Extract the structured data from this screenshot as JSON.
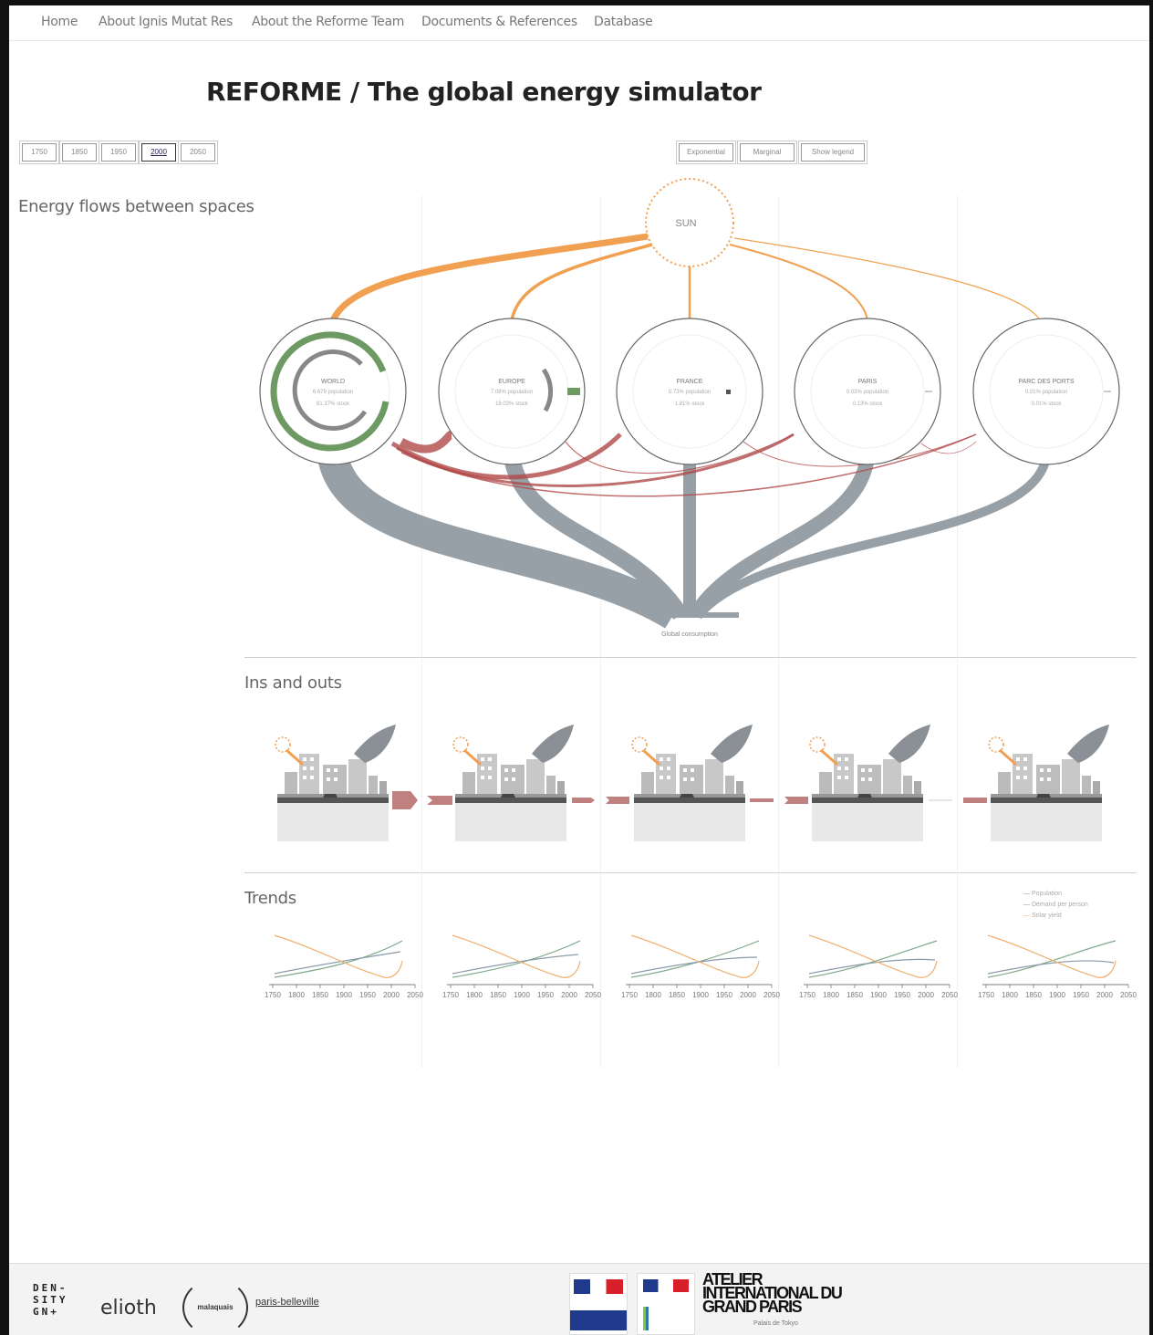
{
  "nav": {
    "items": [
      "Home",
      "About Ignis Mutat Res",
      "About the Reforme Team",
      "Documents & References",
      "Database"
    ]
  },
  "page": {
    "title": "REFORME / The global energy simulator"
  },
  "years": {
    "options": [
      "1750",
      "1850",
      "1950",
      "2000",
      "2050"
    ],
    "selected": "2000"
  },
  "options_buttons": [
    "Exponential",
    "Marginal",
    "Show legend"
  ],
  "flows": {
    "section_title": "Energy flows between spaces",
    "sun_label": "SUN",
    "global_label": "Global consumption",
    "spaces": [
      {
        "name": "WORLD",
        "line1": "6 679 population",
        "line2": "81.37% stock"
      },
      {
        "name": "EUROPE",
        "line1": "7.08% population",
        "line2": "18.03% stock"
      },
      {
        "name": "FRANCE",
        "line1": "0.73% population",
        "line2": "1.81% stock"
      },
      {
        "name": "PARIS",
        "line1": "0.03% population",
        "line2": "0.13% stock"
      },
      {
        "name": "PARC DES PORTS",
        "line1": "0.01% population",
        "line2": "0.01% stock"
      }
    ]
  },
  "ins_outs": {
    "section_title": "Ins and outs"
  },
  "trends": {
    "section_title": "Trends",
    "legend": [
      "Population",
      "Demand per person",
      "Solar yield"
    ],
    "ticks": [
      "1750",
      "1800",
      "1850",
      "1900",
      "1950",
      "2000",
      "2050"
    ]
  },
  "colors": {
    "sun": "#f0a050",
    "population": "#7fa88a",
    "demand": "#8a9aa8",
    "solar": "#f0b070",
    "consumption": "#97a0a6",
    "exchange": "#b04a48",
    "world_ring": "#6d9a62"
  },
  "footer": {
    "logos": [
      "DEN-SITY GN+",
      "elioth",
      "malaquais",
      "paris-belleville"
    ],
    "aigp": "ATELIER INTERNATIONAL DU GRAND PARIS",
    "aigp_sub": "Palais de Tokyo"
  }
}
